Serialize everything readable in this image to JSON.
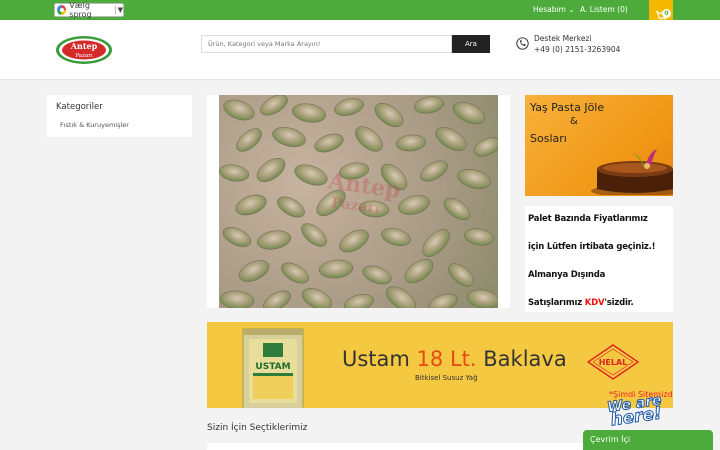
{
  "topbar": {
    "translate_label": "Vælg sprog",
    "translate_arrow": "▼",
    "account_label": "Hesabım",
    "account_chevron": "⌄",
    "wishlist_label": "A. Listem (0)",
    "cart_count": "0"
  },
  "header": {
    "logo_line1": "Antep",
    "logo_line2": "Pazarı",
    "search_placeholder": "Ürün, Kategori veya Marka Arayın!",
    "search_button": "Ara",
    "support_title": "Destek Merkezi",
    "support_phone": "+49 (0) 2151-3263904"
  },
  "sidebar": {
    "title": "Kategoriler",
    "items": [
      {
        "label": "Fıstık & Kuruyemişler"
      }
    ]
  },
  "hero": {
    "watermark_line1": "Antep",
    "watermark_line2": "Pazarı"
  },
  "banner1": {
    "line1": "Yaş Pasta Jöle",
    "line2": "&",
    "line3": "Sosları"
  },
  "banner2": {
    "line1": "Palet Bazında Fiyatlarımız",
    "line2": "için Lütfen irtibata geçiniz.!",
    "line3": "Almanya Dışında",
    "line4_pre": "Satışlarımız ",
    "line4_red": "KDV",
    "line4_post": "'sizdir."
  },
  "wide_banner": {
    "brand": "Ustam",
    "size": "18 Lt.",
    "product": "Baklava",
    "subtitle": "Bitkisel Susuz Yağ",
    "can_label": "USTAM",
    "seal_text": "HELAL",
    "helal_note": "*Şimdi Sitemizde!"
  },
  "section": {
    "title": "Sizin İçin Seçtiklerimiz"
  },
  "chat": {
    "badge_line1": "We are",
    "badge_line2": "here!",
    "label": "Çevrim İçi"
  },
  "colors": {
    "brand_green": "#4cab3a",
    "cart_yellow": "#f5b800",
    "banner_yellow": "#f5c842",
    "accent_orange": "#e64a12"
  }
}
